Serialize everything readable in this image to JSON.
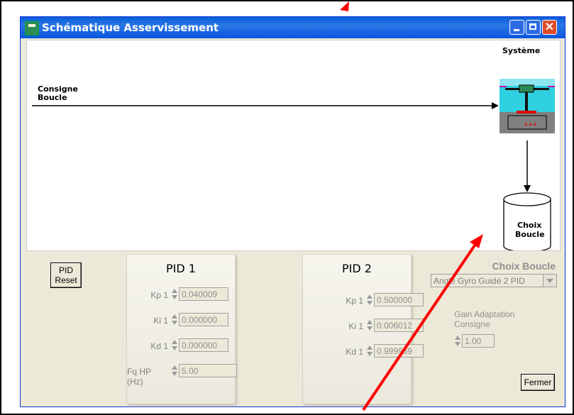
{
  "window": {
    "title": "Schématique Asservissement"
  },
  "diagram": {
    "systeme_label": "Système",
    "consigne_label_1": "Consigne",
    "consigne_label_2": "Boucle",
    "choix_label_1": "Choix",
    "choix_label_2": "Boucle"
  },
  "controls": {
    "pid_reset_1": "PID",
    "pid_reset_2": "Reset",
    "pid1": {
      "title": "PID 1",
      "kp_label": "Kp 1",
      "kp": "0.040009",
      "ki_label": "Ki 1",
      "ki": "0.000000",
      "kd_label": "Kd 1",
      "kd": "0.000000",
      "fq_label": "Fq HP (Hz)",
      "fq": "5.00"
    },
    "pid2": {
      "title": "PID 2",
      "kp_label": "Kp 1",
      "kp": "0.500000",
      "ki_label": "Ki 1",
      "ki": "0.006012",
      "kd_label": "Kd 1",
      "kd": "0.999969"
    },
    "choix_boucle_title": "Choix Boucle",
    "choix_boucle_value": "Angle Gyro Guidé 2 PID",
    "gain_label_1": "Gain Adaptation",
    "gain_label_2": "Consigne",
    "gain_value": "1.00",
    "fermer": "Fermer"
  },
  "colors": {
    "titlebar": "#0a5fd8",
    "arrow": "#ff0000",
    "window_bg": "#ece9d8"
  }
}
